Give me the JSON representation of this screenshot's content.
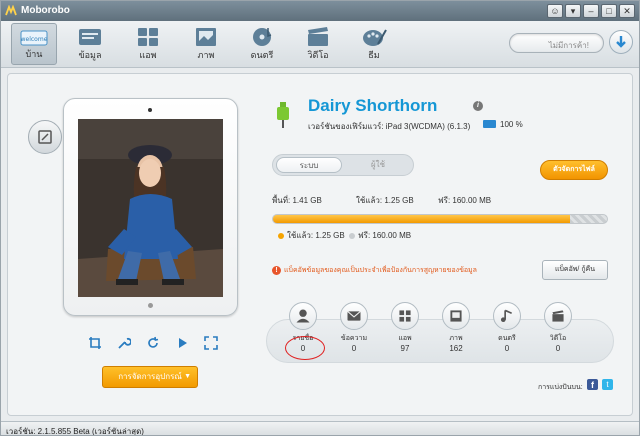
{
  "window": {
    "title": "Moborobo"
  },
  "toolbar": {
    "tabs": [
      {
        "label": "บ้าน",
        "icon": "home-welcome-icon",
        "active": true
      },
      {
        "label": "ข้อมูล",
        "icon": "contacts-icon"
      },
      {
        "label": "แอพ",
        "icon": "apps-icon"
      },
      {
        "label": "ภาพ",
        "icon": "photos-icon"
      },
      {
        "label": "ดนตรี",
        "icon": "music-icon"
      },
      {
        "label": "วิดีโอ",
        "icon": "video-icon"
      },
      {
        "label": "ธีม",
        "icon": "theme-icon"
      }
    ],
    "welcome_text": "welcome",
    "search_placeholder": "ไม่มีการค้า!"
  },
  "device": {
    "name": "Dairy Shorthorn",
    "firmware_label": "เวอร์ชันของเฟิร์มแวร์:",
    "firmware_value": "iPad 3(WCDMA) (6.1.3)",
    "battery": "100 %"
  },
  "storage": {
    "tabs": [
      "ระบบ",
      "ผู้ใช้"
    ],
    "files_button": "ตัวจัดการไฟล์",
    "total_label": "พื้นที่: 1.41 GB",
    "used_label": "ใช้แล้ว: 1.25 GB",
    "free_label": "ฟรี: 160.00 MB",
    "used_fraction": 0.89,
    "legend_used": "ใช้แล้ว: 1.25 GB",
    "legend_free": "ฟรี: 160.00 MB",
    "colors": {
      "used": "#f5a300",
      "free": "#c9cdd0"
    }
  },
  "warning": {
    "text": "แบ็คอัพข้อมูลของคุณเป็นประจำเพื่อป้องกันการสูญหายของข้อมูล",
    "backup_button": "แบ็คอัพ/ กู้คืน"
  },
  "categories": [
    {
      "label": "รายชื่อ",
      "count": "0",
      "icon": "contacts-person-icon"
    },
    {
      "label": "ข้อความ",
      "count": "0",
      "icon": "message-icon"
    },
    {
      "label": "แอพ",
      "count": "97",
      "icon": "apps-grid-icon"
    },
    {
      "label": "ภาพ",
      "count": "162",
      "icon": "photo-icon"
    },
    {
      "label": "ดนตรี",
      "count": "0",
      "icon": "music-note-icon"
    },
    {
      "label": "วิดีโอ",
      "count": "0",
      "icon": "video-clapper-icon"
    }
  ],
  "left": {
    "manage_button": "การจัดการอุปกรณ์"
  },
  "share": {
    "label": "การแบ่งปันบน:"
  },
  "statusbar": {
    "version": "เวอร์ชัน: 2.1.5.855 Beta (เวอร์ชันล่าสุด)"
  }
}
